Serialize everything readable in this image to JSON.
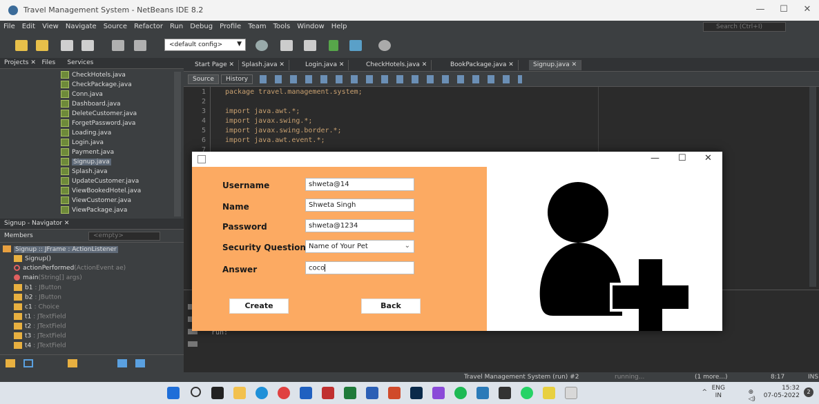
{
  "window": {
    "title": "Travel Management System - NetBeans IDE 8.2"
  },
  "menu": [
    "File",
    "Edit",
    "View",
    "Navigate",
    "Source",
    "Refactor",
    "Run",
    "Debug",
    "Profile",
    "Team",
    "Tools",
    "Window",
    "Help"
  ],
  "search_placeholder": "Search (Ctrl+I)",
  "toolbar": {
    "config": "<default config>"
  },
  "projects": {
    "tabs": [
      "Projects",
      "Files",
      "Services"
    ],
    "files": [
      "CheckHotels.java",
      "CheckPackage.java",
      "Conn.java",
      "Dashboard.java",
      "DeleteCustomer.java",
      "ForgetPassword.java",
      "Loading.java",
      "Login.java",
      "Payment.java",
      "Signup.java",
      "Splash.java",
      "UpdateCustomer.java",
      "ViewBookedHotel.java",
      "ViewCustomer.java",
      "ViewPackage.java"
    ],
    "selected": "Signup.java"
  },
  "navigator": {
    "title": "Signup - Navigator",
    "members_label": "Members",
    "members_filter": "<empty>",
    "root": "Signup :: JFrame : ActionListener",
    "items": [
      {
        "name": "Signup()",
        "type": ""
      },
      {
        "name": "actionPerformed",
        "type": "(ActionEvent ae)"
      },
      {
        "name": "main",
        "type": "(String[] args)"
      },
      {
        "name": "b1",
        "type": " : JButton"
      },
      {
        "name": "b2",
        "type": " : JButton"
      },
      {
        "name": "c1",
        "type": " : Choice"
      },
      {
        "name": "t1",
        "type": " : JTextField"
      },
      {
        "name": "t2",
        "type": " : JTextField"
      },
      {
        "name": "t3",
        "type": " : JTextField"
      },
      {
        "name": "t4",
        "type": " : JTextField"
      }
    ]
  },
  "editor": {
    "tabs": [
      "Start Page",
      "Splash.java",
      "Login.java",
      "CheckHotels.java",
      "BookPackage.java",
      "Signup.java"
    ],
    "active_tab": "Signup.java",
    "source_label": "Source",
    "history_label": "History",
    "lines": [
      {
        "n": "1",
        "text": "package travel.management.system;"
      },
      {
        "n": "2",
        "text": ""
      },
      {
        "n": "3",
        "text": "import java.awt.*;"
      },
      {
        "n": "4",
        "text": "import javax.swing.*;"
      },
      {
        "n": "5",
        "text": "import javax.swing.border.*;"
      },
      {
        "n": "6",
        "text": "import java.awt.event.*;"
      },
      {
        "n": "7",
        "text": ""
      }
    ],
    "output_text": "run:"
  },
  "status": {
    "task": "Travel Management System (run) #2",
    "state": "running...",
    "more": "(1 more...)",
    "position": "8:17",
    "mode": "INS"
  },
  "taskbar": {
    "lang": "ENG",
    "region": "IN",
    "time": "15:32",
    "date": "07-05-2022",
    "badge": "2"
  },
  "signup_form": {
    "fields": [
      {
        "label": "Username",
        "value": "shweta@14"
      },
      {
        "label": "Name",
        "value": "Shweta Singh"
      },
      {
        "label": "Password",
        "value": "shweta@1234"
      }
    ],
    "security_label": "Security Question",
    "security_value": "Name of Your Pet",
    "answer_label": "Answer",
    "answer_value": "coco",
    "create_label": "Create",
    "back_label": "Back",
    "colors": {
      "form_bg": "#fcaa62",
      "image_bg": "#000000"
    }
  }
}
